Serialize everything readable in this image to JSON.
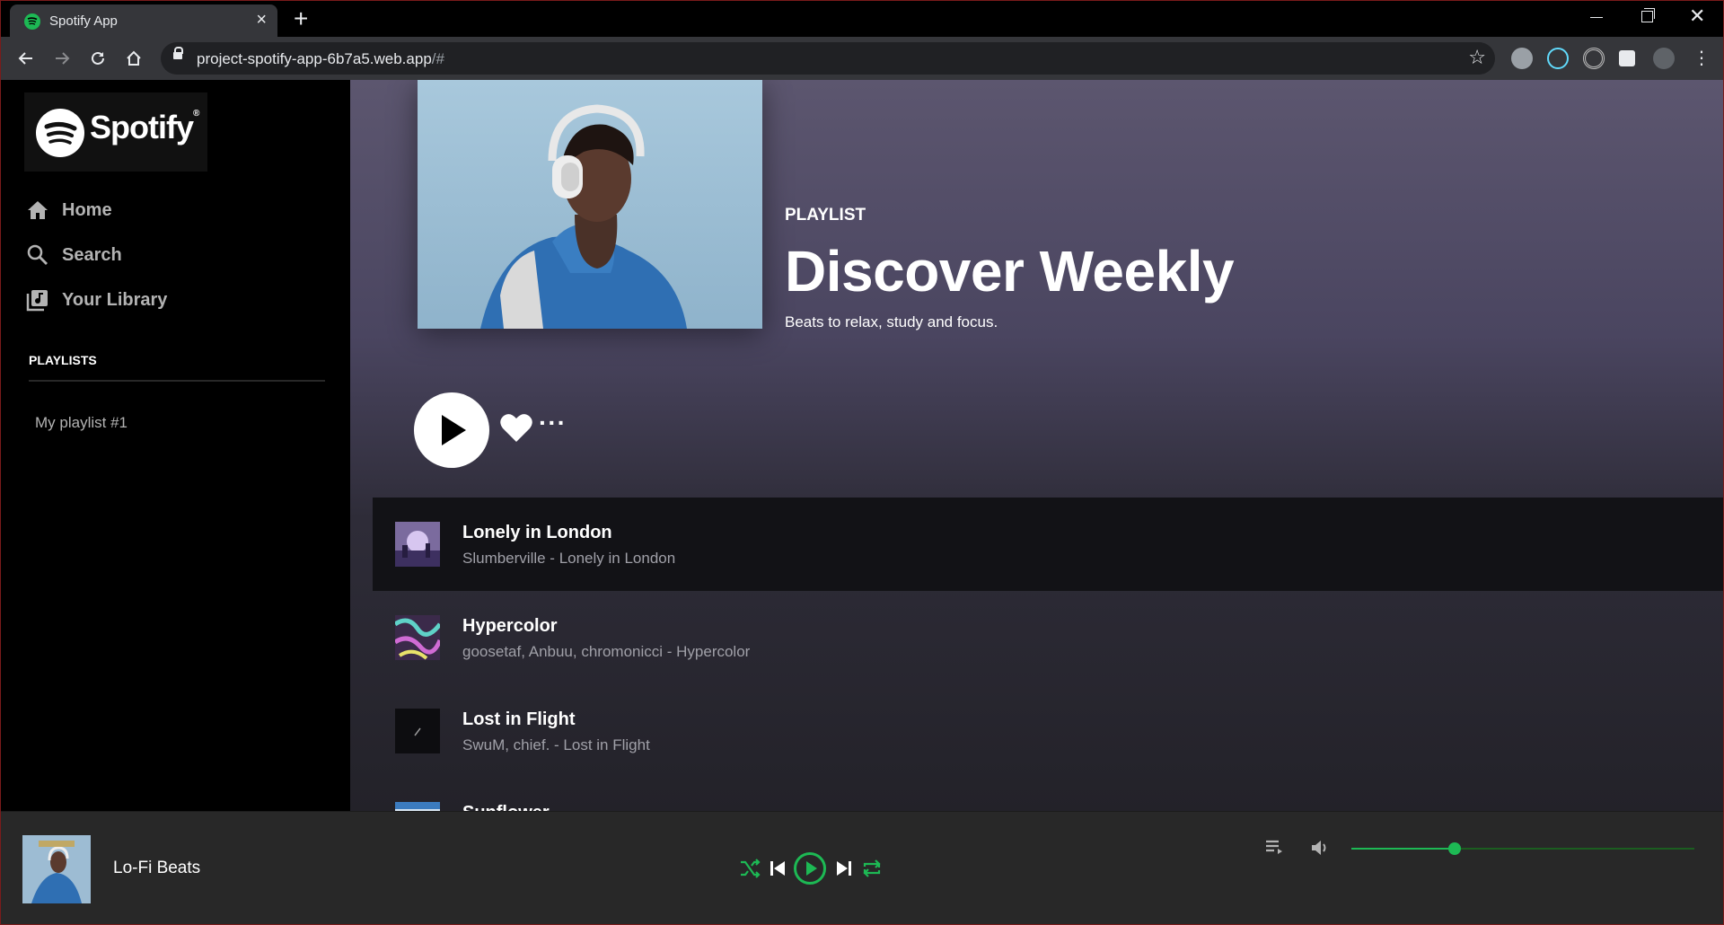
{
  "browser": {
    "tab_title": "Spotify App",
    "url_host": "project-spotify-app-6b7a5.web.app",
    "url_path": "/#"
  },
  "sidebar": {
    "logo_text": "Spotify",
    "nav": [
      {
        "label": "Home",
        "icon": "home-icon"
      },
      {
        "label": "Search",
        "icon": "search-icon"
      },
      {
        "label": "Your Library",
        "icon": "library-icon"
      }
    ],
    "playlists_title": "PLAYLISTS",
    "playlists": [
      "My playlist #1"
    ]
  },
  "header": {
    "type": "PLAYLIST",
    "title": "Discover Weekly",
    "description": "Beats to relax, study and focus."
  },
  "tracks": [
    {
      "title": "Lonely in London",
      "subtitle": "Slumberville - Lonely in London",
      "active": true
    },
    {
      "title": "Hypercolor",
      "subtitle": "goosetaf, Anbuu, chromonicci - Hypercolor",
      "active": false
    },
    {
      "title": "Lost in Flight",
      "subtitle": "SwuM, chief. - Lost in Flight",
      "active": false
    },
    {
      "title": "Sunflower",
      "subtitle": "",
      "active": false
    }
  ],
  "player": {
    "now_playing": "Lo-Fi Beats",
    "volume": 0.3
  },
  "colors": {
    "accent": "#1db954",
    "sidebar_bg": "#000000",
    "footer_bg": "#282828"
  }
}
